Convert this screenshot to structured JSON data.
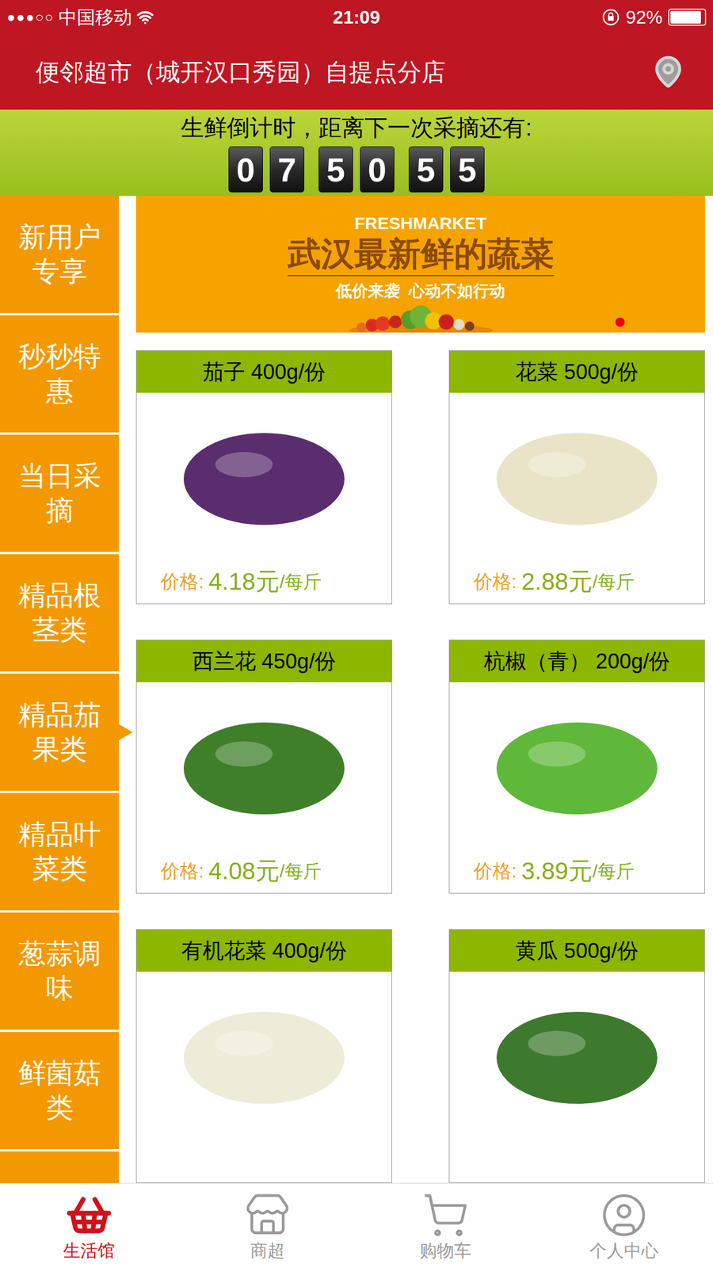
{
  "status_bar": {
    "signal": "●●●○○",
    "carrier": "中国移动",
    "time": "21:09",
    "battery": "92%",
    "battery_level": 0.92
  },
  "header": {
    "title": "便邻超市（城开汉口秀园）自提点分店"
  },
  "countdown": {
    "label": "生鲜倒计时，距离下一次采摘还有:",
    "digits": [
      "0",
      "7",
      "5",
      "0",
      "5",
      "5"
    ]
  },
  "sidebar": {
    "items": [
      {
        "label": "新用户专享",
        "selected": false
      },
      {
        "label": "秒秒特惠",
        "selected": false
      },
      {
        "label": "当日采摘",
        "selected": false
      },
      {
        "label": "精品根茎类",
        "selected": false
      },
      {
        "label": "精品茄果类",
        "selected": true
      },
      {
        "label": "精品叶菜类",
        "selected": false
      },
      {
        "label": "葱蒜调味",
        "selected": false
      },
      {
        "label": "鲜菌菇类",
        "selected": false
      }
    ]
  },
  "banner": {
    "eyebrow": "FRESHMARKET",
    "title": "武汉最新鲜的蔬菜",
    "subtitle": "低价来袭  心动不如行动",
    "pages": [
      {
        "selected": true
      }
    ]
  },
  "products": [
    {
      "name": "茄子 400g/份",
      "price_label": "价格:",
      "price": "4.18元",
      "unit": "/每斤",
      "color": "#5a2d6e"
    },
    {
      "name": "花菜 500g/份",
      "price_label": "价格:",
      "price": "2.88元",
      "unit": "/每斤",
      "color": "#e9e4c8"
    },
    {
      "name": "西兰花 450g/份",
      "price_label": "价格:",
      "price": "4.08元",
      "unit": "/每斤",
      "color": "#3f7f2a"
    },
    {
      "name": "杭椒（青） 200g/份",
      "price_label": "价格:",
      "price": "3.89元",
      "unit": "/每斤",
      "color": "#5fb83a"
    },
    {
      "name": "有机花菜 400g/份",
      "price_label": "",
      "price": "",
      "unit": "",
      "color": "#eeecd9"
    },
    {
      "name": "黄瓜 500g/份",
      "price_label": "",
      "price": "",
      "unit": "",
      "color": "#3d7a2e"
    }
  ],
  "tab_bar": {
    "items": [
      {
        "label": "生活馆",
        "selected": true
      },
      {
        "label": "商超",
        "selected": false
      },
      {
        "label": "购物车",
        "selected": false
      },
      {
        "label": "个人中心",
        "selected": false
      }
    ]
  }
}
